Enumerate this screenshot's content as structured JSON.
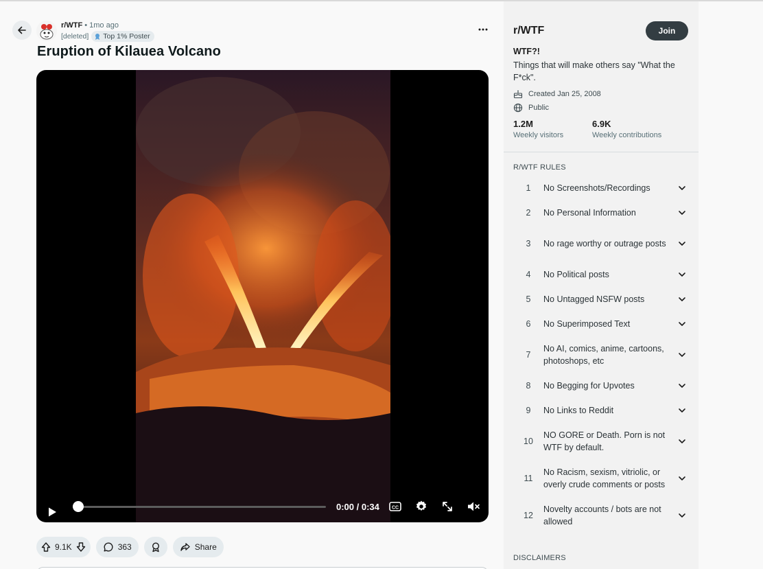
{
  "post": {
    "subreddit": "r/WTF",
    "separator": "•",
    "time_ago": "1mo ago",
    "author": "[deleted]",
    "flair": "Top 1% Poster",
    "title": "Eruption of Kilauea Volcano"
  },
  "video": {
    "time": "0:00 / 0:34",
    "progress": 0
  },
  "actions": {
    "upvotes": "9.1K",
    "comments": "363",
    "share_label": "Share"
  },
  "sidebar": {
    "name": "r/WTF",
    "join_label": "Join",
    "tagline": "WTF?!",
    "description": "Things that will make others say \"What the F*ck\".",
    "created": "Created Jan 25, 2008",
    "visibility": "Public",
    "stats": [
      {
        "value": "1.2M",
        "label": "Weekly visitors"
      },
      {
        "value": "6.9K",
        "label": "Weekly contributions"
      }
    ],
    "rules_heading": "R/WTF RULES",
    "rules": [
      {
        "num": "1",
        "text": "No Screenshots/Recordings"
      },
      {
        "num": "2",
        "text": "No Personal Information"
      },
      {
        "num": "3",
        "text": "No rage worthy or outrage posts"
      },
      {
        "num": "4",
        "text": "No Political posts"
      },
      {
        "num": "5",
        "text": "No Untagged NSFW posts"
      },
      {
        "num": "6",
        "text": "No Superimposed Text"
      },
      {
        "num": "7",
        "text": "No AI, comics, anime, cartoons, photoshops, etc"
      },
      {
        "num": "8",
        "text": "No Begging for Upvotes"
      },
      {
        "num": "9",
        "text": "No Links to Reddit"
      },
      {
        "num": "10",
        "text": "NO GORE or Death. Porn is not WTF by default."
      },
      {
        "num": "11",
        "text": "No Racism, sexism, vitriolic, or overly crude comments or posts"
      },
      {
        "num": "12",
        "text": "Novelty accounts / bots are not allowed"
      }
    ],
    "disclaimers_heading": "DISCLAIMERS"
  },
  "colors": {
    "join_bg": "#333d42",
    "pill_bg": "#e5ebee",
    "lava": "#ff7a1a"
  }
}
